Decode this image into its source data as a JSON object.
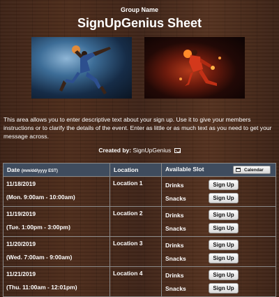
{
  "header": {
    "group_name": "Group Name",
    "title": "SignUpGenius Sheet"
  },
  "description": "This area allows you to enter descriptive text about your sign up. Use it to give your members instructions or to clarify the details of the event. Enter as little or as much text as you need to get your message across.",
  "created_by": {
    "label": "Created by:",
    "name": "SignUpGenius"
  },
  "table": {
    "col_date": "Date",
    "col_date_format": "(mm/dd/yyyy EST)",
    "col_location": "Location",
    "col_slot": "Available Slot",
    "calendar_label": "Calendar",
    "signup_label": "Sign Up",
    "rows": [
      {
        "date": "11/18/2019",
        "time": "(Mon. 9:00am - 10:00am)",
        "location": "Location 1",
        "slots": [
          "Drinks",
          "Snacks"
        ]
      },
      {
        "date": "11/19/2019",
        "time": "(Tue. 1:00pm - 3:00pm)",
        "location": "Location 2",
        "slots": [
          "Drinks",
          "Snacks"
        ]
      },
      {
        "date": "11/20/2019",
        "time": "(Wed. 7:00am - 9:00am)",
        "location": "Location 3",
        "slots": [
          "Drinks",
          "Snacks"
        ]
      },
      {
        "date": "11/21/2019",
        "time": "(Thu. 11:00am - 12:01pm)",
        "location": "Location 4",
        "slots": [
          "Drinks",
          "Snacks"
        ]
      }
    ]
  },
  "icons": {
    "mail": "envelope-icon",
    "calendar": "calendar-icon"
  }
}
